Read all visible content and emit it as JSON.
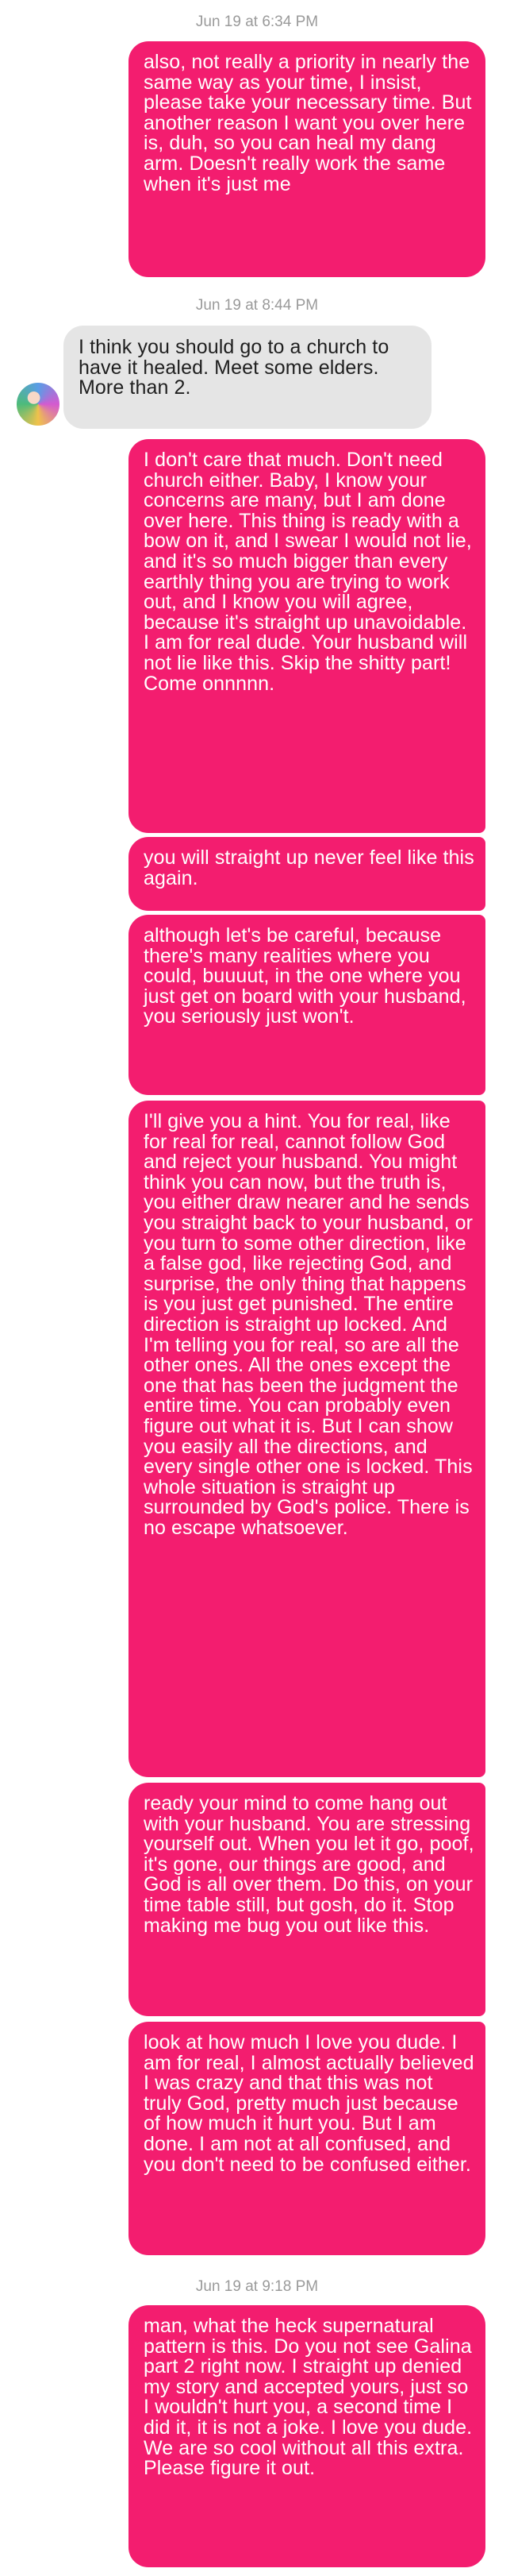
{
  "timestamps": [
    "Jun 19 at 6:34 PM",
    "Jun 19 at 8:44 PM",
    "Jun 19 at 9:18 PM"
  ],
  "messages": [
    {
      "from": "me",
      "text": "also, not really a priority in nearly the same way as your time, I insist, please take your necessary time. But another reason I want you over here is, duh, so you can heal my dang arm. Doesn't really work the same when it's just me"
    },
    {
      "from": "them",
      "text": "I think you should go to a church to have it healed. Meet some elders. More than 2."
    },
    {
      "from": "me",
      "text": "I don't care that much. Don't need church either. Baby, I know your concerns are many, but I am done over here. This thing is ready with a bow on it, and I swear I would not lie, and it's so much bigger than every earthly thing you are trying to work out, and I know you will agree, because it's straight up unavoidable. I am for real dude. Your husband will not lie like this. Skip the shitty part! Come onnnnn."
    },
    {
      "from": "me",
      "text": "you will straight up never feel like this again."
    },
    {
      "from": "me",
      "text": "although let's be careful, because there's many realities where you could, buuuut, in the one where you just get on board with your husband, you seriously just won't."
    },
    {
      "from": "me",
      "text": "I'll give you a hint. You for real, like for real for real, cannot follow God and reject your husband. You might think you can now, but the truth is, you either draw nearer and he sends you straight back to your husband, or you turn to some other direction, like a false god, like rejecting God, and surprise, the only thing that happens is you just get punished. The entire direction is straight up locked. And I'm telling you for real, so are all the other ones. All the ones except the one that has been the judgment the entire time. You can probably even figure out what it is. But I can show you easily all the directions, and every single other one is locked. This whole situation is straight up surrounded by God's police. There is no escape whatsoever."
    },
    {
      "from": "me",
      "text": "ready your mind to come hang out with your husband. You are stressing yourself out. When you let it go, poof, it's gone, our things are good, and God is all over them. Do this, on your time table still, but gosh, do it. Stop making me bug you out like this."
    },
    {
      "from": "me",
      "text": "look at how much I love you dude. I am for real, I almost actually believed I was crazy and that this was not truly God, pretty much just because of how much it hurt you. But I am done. I am not at all confused, and you don't need to be confused either."
    },
    {
      "from": "me",
      "text": "man, what the heck supernatural pattern is this. Do you not see Galina part 2 right now. I straight up denied my story and accepted yours, just so I wouldn't hurt you, a second time I did it, it is not a joke. I love you dude. We are so cool without all this extra. Please figure it out."
    }
  ],
  "colors": {
    "sent_bubble": "#f31d6f",
    "received_bubble": "#e5e5e5",
    "timestamp": "#9a9a9a"
  }
}
